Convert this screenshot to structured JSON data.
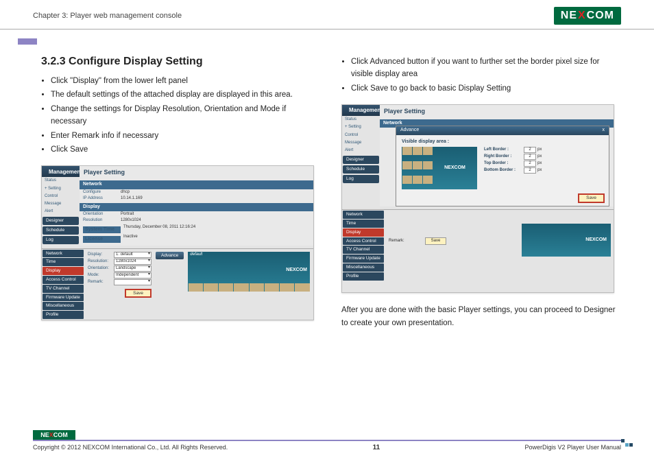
{
  "header": {
    "chapter": "Chapter 3: Player web management console",
    "logo": {
      "brand": "NE",
      "x": "X",
      "brand2": "COM"
    }
  },
  "page": {
    "heading": "3.2.3 Configure Display Setting",
    "bullets_left": [
      "Click \"Display\" from the lower left panel",
      "The default settings of the attached display are displayed in this area.",
      "Change the settings for Display Resolution, Orientation and Mode if necessary",
      "Enter Remark info if necessary",
      "Click Save"
    ],
    "bullets_right": [
      "Click Advanced button if you want to further set the border pixel size for visible display area",
      "Click Save to go back to basic Display Setting"
    ],
    "closing": "After you are done with the basic Player settings, you can proceed to Designer to create your own presentation."
  },
  "shot1": {
    "title_mgmt": "Management",
    "title_page": "Player Setting",
    "side_items": [
      "Status",
      "+ Setting",
      "Control",
      "Message",
      "Alert"
    ],
    "side_tabs": [
      "Designer",
      "Schedule",
      "Log"
    ],
    "sections": {
      "network": {
        "head": "Network",
        "rows": [
          {
            "k": "Configure",
            "v": "dhcp"
          },
          {
            "k": "IP Address",
            "v": "10.14.1.169"
          }
        ]
      },
      "display": {
        "head": "Display",
        "rows": [
          {
            "k": "Orientation",
            "v": "Portrait"
          },
          {
            "k": "Resolution",
            "v": "1280x1024"
          }
        ]
      },
      "systime": {
        "head": "System Time",
        "v": "Thursday, December 08, 2011 12:16:24"
      },
      "license": {
        "head": "License",
        "v": "Inactive"
      }
    },
    "lower_menu": [
      "Network",
      "Time",
      "Display",
      "Access Control",
      "TV Channel",
      "Firmware Update",
      "Miscellaneous",
      "Profile"
    ],
    "lower_menu_active": "Display",
    "form": {
      "rows": [
        {
          "label": "Display:",
          "value": "1: default"
        },
        {
          "label": "Resolution:",
          "value": "1280x1024"
        },
        {
          "label": "Orientation:",
          "value": "Landscape"
        },
        {
          "label": "Mode:",
          "value": "Independent"
        },
        {
          "label": "Remark:",
          "value": ""
        }
      ],
      "advance": "Advance",
      "save": "Save",
      "preview_label": "default",
      "preview_logo": "NEXCOM"
    }
  },
  "shot2": {
    "title_mgmt": "Management",
    "title_page": "Player Setting",
    "side_items": [
      "Status",
      "+ Setting",
      "Control",
      "Message",
      "Alert"
    ],
    "side_tabs": [
      "Designer",
      "Schedule",
      "Log"
    ],
    "sections": {
      "network": {
        "head": "Network"
      }
    },
    "lower_menu": [
      "Network",
      "Time",
      "Display",
      "Access Control",
      "TV Channel",
      "Firmware Update",
      "Miscellaneous",
      "Profile"
    ],
    "lower_menu_active": "Display",
    "form_remark_label": "Remark:",
    "modal": {
      "title": "Advance",
      "close": "x",
      "heading": "Visible display area :",
      "borders": [
        {
          "label": "Left Border :",
          "val": "2",
          "unit": "px"
        },
        {
          "label": "Right Border :",
          "val": "2",
          "unit": "px"
        },
        {
          "label": "Top Border :",
          "val": "2",
          "unit": "px"
        },
        {
          "label": "Bottom Border :",
          "val": "2",
          "unit": "px"
        }
      ],
      "preview_logo": "NEXCOM",
      "save": "Save"
    },
    "bg_save": "Save",
    "bg_logo": "NEXCOM"
  },
  "footer": {
    "copyright": "Copyright © 2012 NEXCOM International Co., Ltd. All Rights Reserved.",
    "page_number": "11",
    "doc_title": "PowerDigis V2 Player User Manual"
  }
}
